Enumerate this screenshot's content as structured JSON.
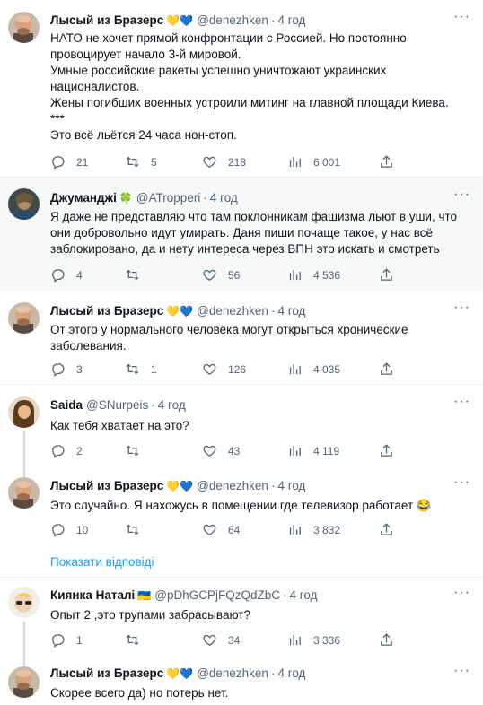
{
  "tweets": [
    {
      "name": "Лысый из Бразерс",
      "emoji": "💛💙",
      "handle": "@denezhken",
      "dot": "·",
      "time": "4 год",
      "lines": [
        "НАТО не хочет прямой конфронтации с Россией. Но постоянно",
        "провоцирует начало 3-й мировой.",
        "Умные российские ракеты успешно уничтожают украинских",
        "националистов.",
        "Жены погибших военных устроили митинг на главной площади Киева.",
        "***",
        "Это всё льётся 24 часа нон-стоп."
      ],
      "replies": "21",
      "retweets": "5",
      "likes": "218",
      "views": "6 001"
    },
    {
      "name": "Джуманджі",
      "emoji": "🍀",
      "handle": "@ATropperi",
      "dot": "·",
      "time": "4 год",
      "lines": [
        "Я даже не представляю что там поклонникам фашизма льют в уши, что",
        "они добровольно идут умирать. Даня пиши почаще такое, у нас всё",
        "заблокировано, да и нету интереса через ВПН это искать и смотреть"
      ],
      "replies": "4",
      "retweets": "",
      "likes": "56",
      "views": "4 536"
    },
    {
      "name": "Лысый из Бразерс",
      "emoji": "💛💙",
      "handle": "@denezhken",
      "dot": "·",
      "time": "4 год",
      "lines": [
        "От этого у нормального человека могут открыться хронические",
        "заболевания."
      ],
      "replies": "3",
      "retweets": "1",
      "likes": "126",
      "views": "4 035"
    },
    {
      "name": "Saida",
      "emoji": "",
      "handle": "@SNurpeis",
      "dot": "·",
      "time": "4 год",
      "lines": [
        "Как тебя хватает на это?"
      ],
      "replies": "2",
      "retweets": "",
      "likes": "43",
      "views": "4 119"
    },
    {
      "name": "Лысый из Бразерс",
      "emoji": "💛💙",
      "handle": "@denezhken",
      "dot": "·",
      "time": "4 год",
      "lines": [
        "Это случайно. Я нахожусь в помещении где телевизор работает 😂"
      ],
      "replies": "10",
      "retweets": "",
      "likes": "64",
      "views": "3 832"
    },
    {
      "name": "Киянка Наталі",
      "emoji": "🇺🇦",
      "handle": "@pDhGCPjFQzQdZbC",
      "dot": "·",
      "time": "4 год",
      "lines": [
        "Опыт 2 ,это трупами забрасывают?"
      ],
      "replies": "1",
      "retweets": "",
      "likes": "34",
      "views": "3 336"
    },
    {
      "name": "Лысый из Бразерс",
      "emoji": "💛💙",
      "handle": "@denezhken",
      "dot": "·",
      "time": "4 год",
      "lines": [
        "Скорее всего да) но потерь нет."
      ]
    }
  ],
  "show_replies": "Показати відповіді",
  "icons": {
    "reply": "reply-icon",
    "retweet": "retweet-icon",
    "like": "like-icon",
    "views": "views-icon",
    "share": "share-icon",
    "more": "more-icon"
  },
  "colors": {
    "text": "#0f1419",
    "muted": "#536471",
    "link": "#1d9bf0",
    "highlight_bg": "#f7f9f9",
    "divider": "#eff3f4"
  }
}
